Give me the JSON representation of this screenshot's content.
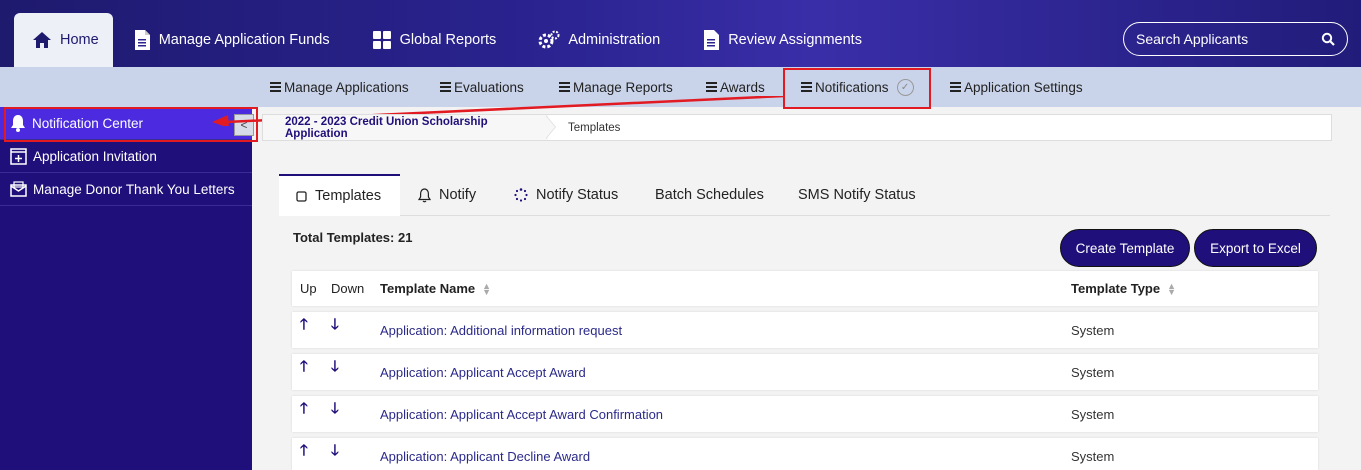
{
  "topnav": {
    "home": "Home",
    "funds": "Manage Application Funds",
    "reports": "Global Reports",
    "admin": "Administration",
    "review": "Review Assignments",
    "search_label": "Search Applicants"
  },
  "subnav": {
    "items": [
      "Manage Applications",
      "Evaluations",
      "Manage Reports",
      "Awards",
      "Notifications",
      "Application Settings"
    ]
  },
  "sidebar": {
    "items": [
      "Notification Center",
      "Application Invitation",
      "Manage Donor Thank You Letters"
    ],
    "collapse": "<"
  },
  "breadcrumb": {
    "app": "2022 - 2023 Credit Union Scholarship Application",
    "page": "Templates"
  },
  "tabs": [
    "Templates",
    "Notify",
    "Notify Status",
    "Batch Schedules",
    "SMS Notify Status"
  ],
  "summary": {
    "total": "Total Templates: 21"
  },
  "buttons": {
    "create": "Create Template",
    "export": "Export to Excel"
  },
  "table": {
    "headers": {
      "up": "Up",
      "down": "Down",
      "name": "Template Name",
      "type": "Template Type"
    },
    "rows": [
      {
        "name": "Application: Additional information request",
        "type": "System"
      },
      {
        "name": "Application: Applicant Accept Award",
        "type": "System"
      },
      {
        "name": "Application: Applicant Accept Award Confirmation",
        "type": "System"
      },
      {
        "name": "Application: Applicant Decline Award",
        "type": "System"
      }
    ]
  },
  "colors": {
    "navy": "#1f0f7a",
    "highlight": "#e21b23",
    "subnav_bg": "#c9d3ea"
  }
}
